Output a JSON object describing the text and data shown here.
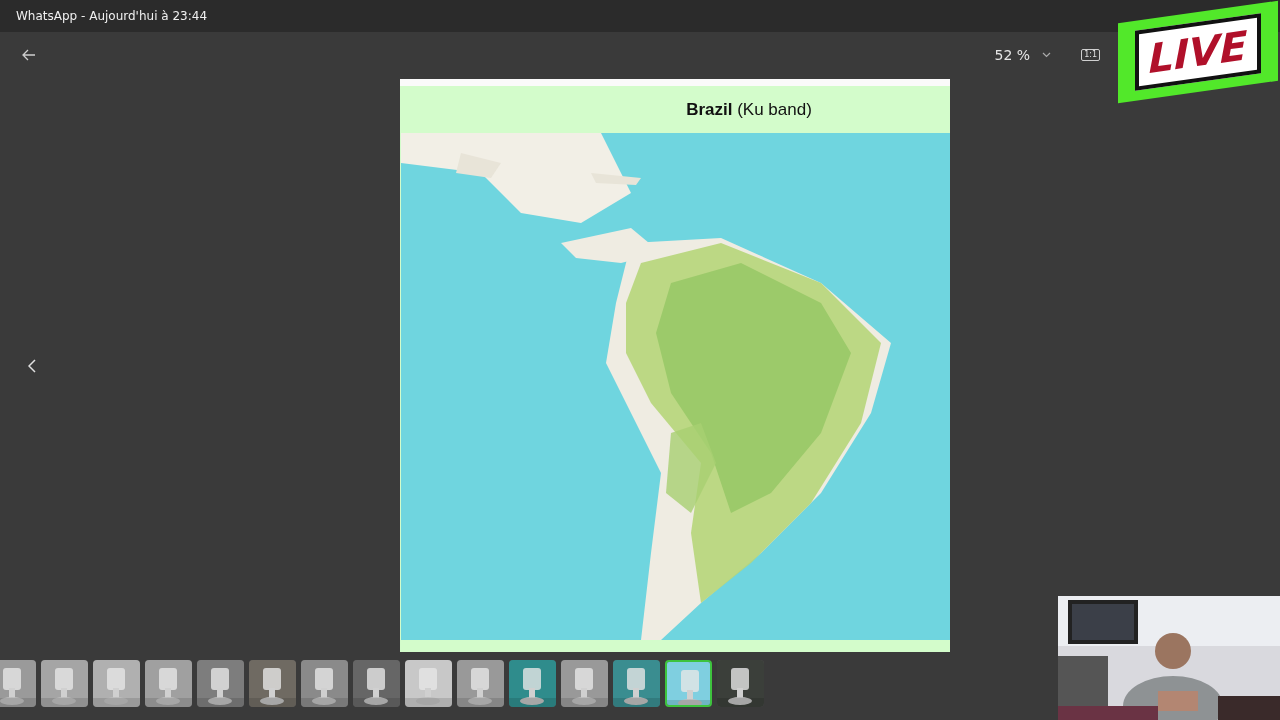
{
  "window": {
    "title": "WhatsApp - Aujourd'hui à 23:44"
  },
  "toolbar": {
    "zoom": "52 %",
    "actual_size": "1:1"
  },
  "image": {
    "title_bold": "Brazil",
    "title_rest": "(Ku band)"
  },
  "thumbnails": [
    {
      "selected": false
    },
    {
      "selected": false
    },
    {
      "selected": false
    },
    {
      "selected": false
    },
    {
      "selected": false
    },
    {
      "selected": false
    },
    {
      "selected": false
    },
    {
      "selected": false
    },
    {
      "selected": false
    },
    {
      "selected": false
    },
    {
      "selected": false
    },
    {
      "selected": false
    },
    {
      "selected": false
    },
    {
      "selected": true
    },
    {
      "selected": false
    }
  ],
  "overlay": {
    "live_badge": "LIVE"
  }
}
